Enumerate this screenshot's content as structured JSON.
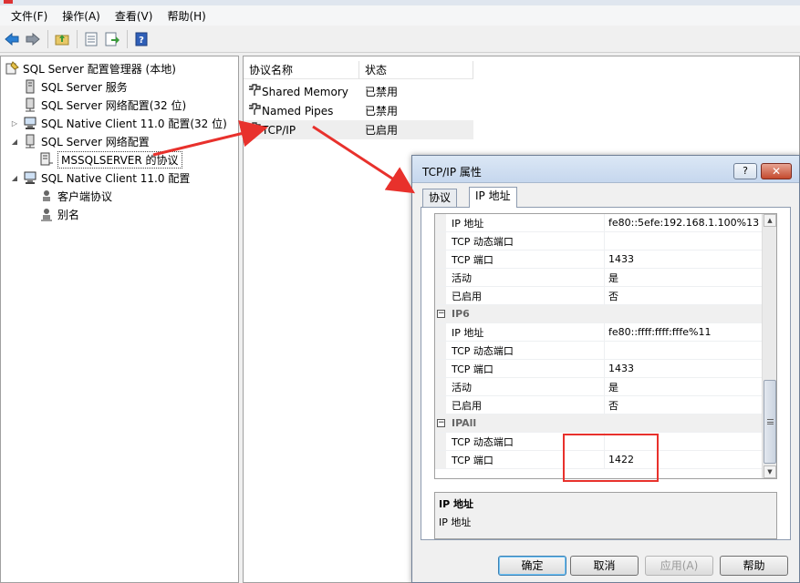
{
  "menubar": {
    "items": [
      "文件(F)",
      "操作(A)",
      "查看(V)",
      "帮助(H)"
    ]
  },
  "tree": {
    "root": "SQL Server 配置管理器 (本地)",
    "services": "SQL Server 服务",
    "net32": "SQL Server 网络配置(32 位)",
    "native32": "SQL Native Client 11.0 配置(32 位)",
    "net": "SQL Server 网络配置",
    "mssql": "MSSQLSERVER 的协议",
    "native": "SQL Native Client 11.0 配置",
    "client": "客户端协议",
    "alias": "别名"
  },
  "protocols": {
    "col_name": "协议名称",
    "col_status": "状态",
    "rows": [
      {
        "name": "Shared Memory",
        "status": "已禁用"
      },
      {
        "name": "Named Pipes",
        "status": "已禁用"
      },
      {
        "name": "TCP/IP",
        "status": "已启用"
      }
    ]
  },
  "dialog": {
    "title": "TCP/IP 属性",
    "help_glyph": "?",
    "close_glyph": "✕",
    "tab_protocol": "协议",
    "tab_ip": "IP 地址",
    "grid": {
      "r0": {
        "k": "IP 地址",
        "v": "fe80::5efe:192.168.1.100%13"
      },
      "r1": {
        "k": "TCP 动态端口",
        "v": ""
      },
      "r2": {
        "k": "TCP 端口",
        "v": "1433"
      },
      "r3": {
        "k": "活动",
        "v": "是"
      },
      "r4": {
        "k": "已启用",
        "v": "否"
      },
      "cat_ip6": "IP6",
      "r6": {
        "k": "IP 地址",
        "v": "fe80::ffff:ffff:fffe%11"
      },
      "r7": {
        "k": "TCP 动态端口",
        "v": ""
      },
      "r8": {
        "k": "TCP 端口",
        "v": "1433"
      },
      "r9": {
        "k": "活动",
        "v": "是"
      },
      "r10": {
        "k": "已启用",
        "v": "否"
      },
      "cat_ipall": "IPAll",
      "r12": {
        "k": "TCP 动态端口",
        "v": ""
      },
      "r13": {
        "k": "TCP 端口",
        "v": "1422"
      }
    },
    "desc_title": "IP 地址",
    "desc_text": "IP 地址",
    "ok": "确定",
    "cancel": "取消",
    "apply": "应用(A)",
    "help": "帮助"
  },
  "colors": {
    "annotation_red": "#e8312c",
    "selection_gray": "#eeeeee"
  }
}
